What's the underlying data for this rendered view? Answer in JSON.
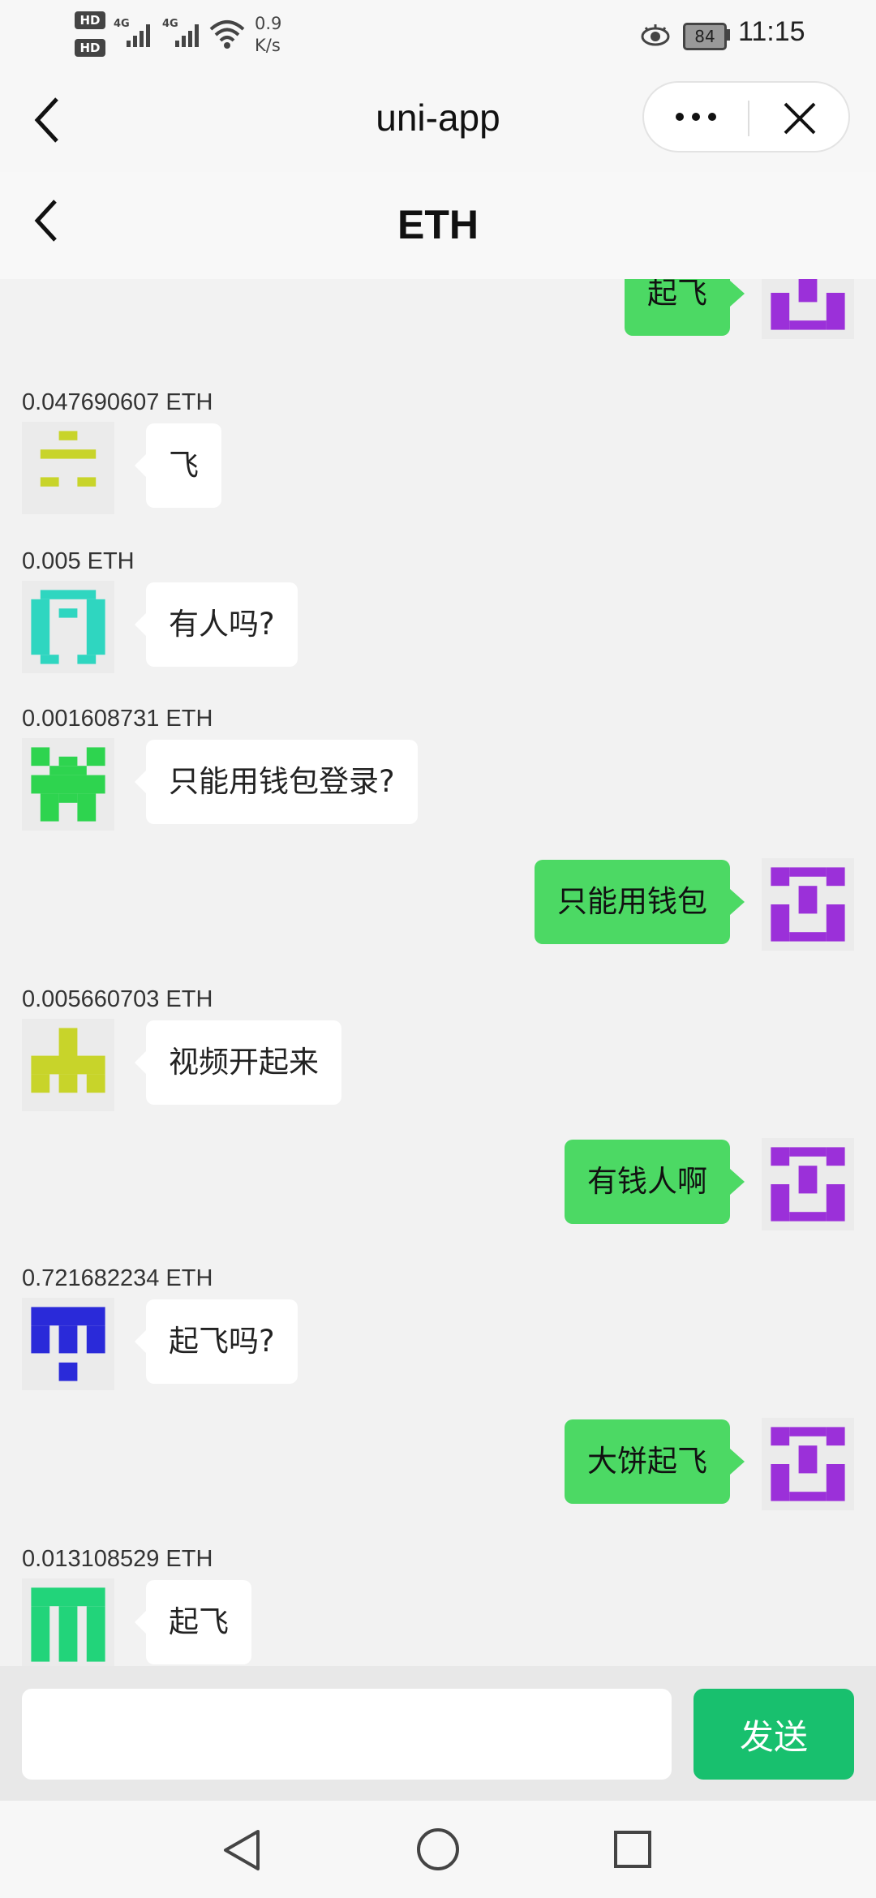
{
  "status_bar": {
    "net_speed_value": "0.9",
    "net_speed_unit": "K/s",
    "network_type": "4G",
    "sim_labels": [
      "HD",
      "HD"
    ],
    "battery": "84",
    "time": "11:15",
    "icons": [
      "signal-icon",
      "wifi-icon",
      "eye-care-icon",
      "battery-icon"
    ]
  },
  "mp_nav": {
    "title": "uni-app"
  },
  "page_header": {
    "title": "ETH"
  },
  "messages": [
    {
      "side": "out",
      "text": "起飞",
      "avatar_color": "#9b30d9"
    },
    {
      "side": "in",
      "amount": "0.047690607 ETH",
      "text": "飞",
      "avatar_color": "#c8d42a"
    },
    {
      "side": "in",
      "amount": "0.005 ETH",
      "text": "有人吗?",
      "avatar_color": "#2fd6c0"
    },
    {
      "side": "in",
      "amount": "0.001608731 ETH",
      "text": "只能用钱包登录?",
      "avatar_color": "#2ed44f"
    },
    {
      "side": "out",
      "text": "只能用钱包",
      "avatar_color": "#9b30d9"
    },
    {
      "side": "in",
      "amount": "0.005660703 ETH",
      "text": "视频开起来",
      "avatar_color": "#c8d42a"
    },
    {
      "side": "out",
      "text": "有钱人啊",
      "avatar_color": "#9b30d9"
    },
    {
      "side": "in",
      "amount": "0.721682234 ETH",
      "text": "起飞吗?",
      "avatar_color": "#2a2ad9"
    },
    {
      "side": "out",
      "text": "大饼起飞",
      "avatar_color": "#9b30d9"
    },
    {
      "side": "in",
      "amount": "0.013108529 ETH",
      "text": "起飞",
      "avatar_color": "#22d47a"
    }
  ],
  "input_bar": {
    "placeholder": "",
    "send_label": "发送"
  },
  "colors": {
    "outgoing_bubble": "#4cd964",
    "incoming_bubble": "#ffffff",
    "send_button": "#18c06e",
    "background": "#f2f2f2"
  }
}
